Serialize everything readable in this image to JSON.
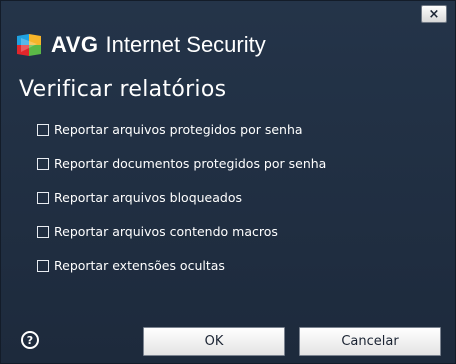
{
  "window": {
    "close_label": "×"
  },
  "header": {
    "brand": "AVG",
    "product": "Internet Security",
    "logo_icon": "avg-logo-icon"
  },
  "page": {
    "title": "Verificar relatórios"
  },
  "options": [
    {
      "label": "Reportar arquivos protegidos por senha",
      "checked": false
    },
    {
      "label": "Reportar documentos protegidos por senha",
      "checked": false
    },
    {
      "label": "Reportar arquivos bloqueados",
      "checked": false
    },
    {
      "label": "Reportar arquivos contendo macros",
      "checked": false
    },
    {
      "label": "Reportar extensões ocultas",
      "checked": false
    }
  ],
  "footer": {
    "help_icon": "help-icon",
    "help_glyph": "?",
    "ok_label": "OK",
    "cancel_label": "Cancelar"
  },
  "colors": {
    "background": "#1d2a3c",
    "text": "#ffffff",
    "button_bg": "#f0f0f0"
  }
}
